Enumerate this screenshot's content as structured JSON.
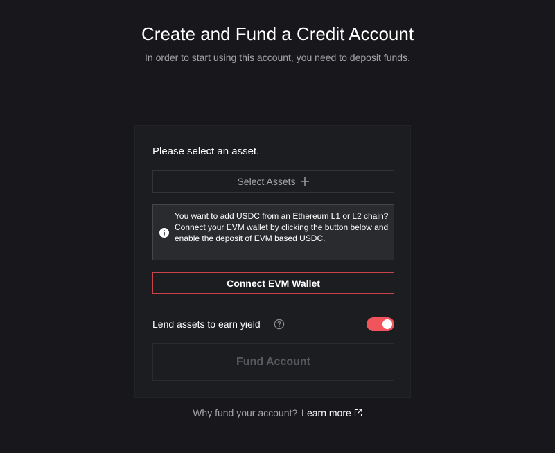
{
  "header": {
    "title": "Create and Fund a Credit Account",
    "subtitle": "In order to start using this account, you need to deposit funds."
  },
  "card": {
    "heading": "Please select an asset.",
    "select_assets_label": "Select Assets",
    "info_text": "You want to add USDC from an Ethereum L1 or L2 chain? Connect your EVM wallet by clicking the button below and enable the deposit of EVM based USDC.",
    "connect_button_label": "Connect EVM Wallet",
    "lend_label": "Lend assets to earn yield",
    "lend_enabled": true,
    "fund_button_label": "Fund Account"
  },
  "footer": {
    "question": "Why fund your account?",
    "link_label": "Learn more"
  },
  "colors": {
    "background": "#18181c",
    "card": "#1c1d21",
    "accent": "#f2545b",
    "connect_border": "#c8434a"
  },
  "icons": {
    "plus": "plus-icon",
    "info": "info-icon",
    "help": "help-circle-icon",
    "external": "external-link-icon"
  }
}
